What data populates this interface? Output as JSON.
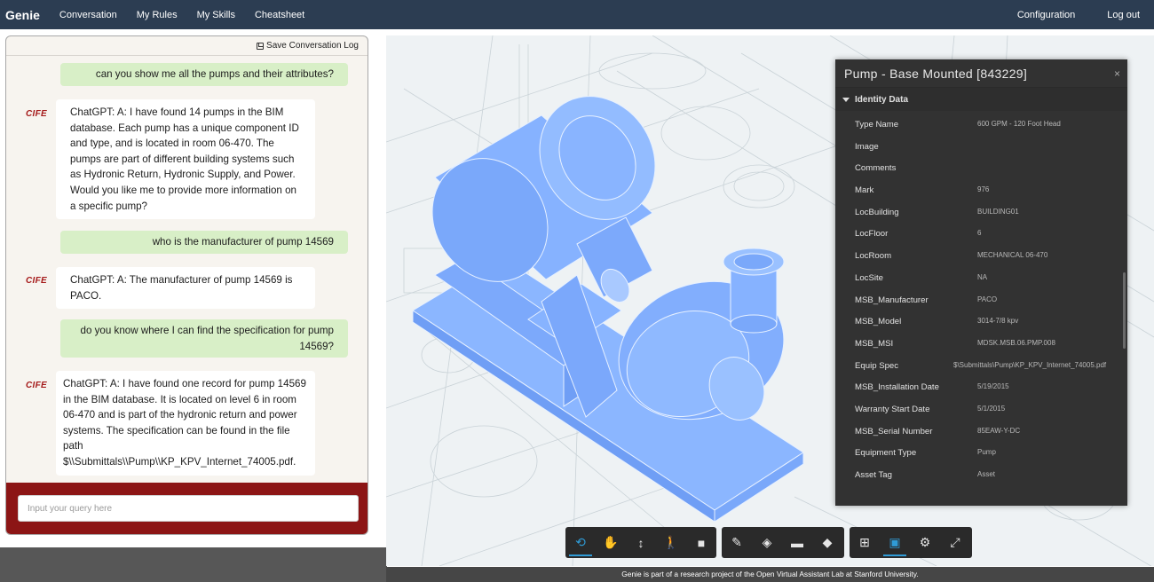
{
  "navbar": {
    "brand": "Genie",
    "links": [
      "Conversation",
      "My Rules",
      "My Skills",
      "Cheatsheet"
    ],
    "right_links": [
      "Configuration",
      "Log out"
    ]
  },
  "chat": {
    "save_log_label": "Save Conversation Log",
    "bot_logo_text": "CIFE",
    "messages": [
      {
        "role": "user",
        "text": "can you show me all the pumps and their attributes?"
      },
      {
        "role": "bot",
        "text": "ChatGPT: A: I have found 14 pumps in the BIM database. Each pump has a unique component ID and type, and is located in room 06-470. The pumps are part of different building systems such as Hydronic Return, Hydronic Supply, and Power. Would you like me to provide more information on a specific pump?"
      },
      {
        "role": "user",
        "text": "who is the manufacturer of pump 14569"
      },
      {
        "role": "bot",
        "text": "ChatGPT: A: The manufacturer of pump 14569 is PACO."
      },
      {
        "role": "user",
        "text": "do you know where I can find the specification for pump 14569?"
      },
      {
        "role": "bot",
        "text": "ChatGPT: A: I have found one record for pump 14569 in the BIM database. It is located on level 6 in room 06-470 and is part of the hydronic return and power systems. The specification can be found in the file path $\\\\Submittals\\\\Pump\\\\KP_KPV_Internet_74005.pdf."
      }
    ],
    "input_placeholder": "Input your query here"
  },
  "properties": {
    "title": "Pump - Base Mounted [843229]",
    "close_glyph": "×",
    "section": "Identity Data",
    "rows": [
      {
        "key": "Type Name",
        "value": "600 GPM - 120 Foot Head"
      },
      {
        "key": "Image",
        "value": ""
      },
      {
        "key": "Comments",
        "value": ""
      },
      {
        "key": "Mark",
        "value": "976"
      },
      {
        "key": "LocBuilding",
        "value": "BUILDING01"
      },
      {
        "key": "LocFloor",
        "value": "6"
      },
      {
        "key": "LocRoom",
        "value": "MECHANICAL 06-470"
      },
      {
        "key": "LocSite",
        "value": "NA"
      },
      {
        "key": "MSB_Manufacturer",
        "value": "PACO"
      },
      {
        "key": "MSB_Model",
        "value": "3014-7/8 kpv"
      },
      {
        "key": "MSB_MSI",
        "value": "MDSK.MSB.06.PMP.008"
      },
      {
        "key": "Equip Spec",
        "value": "$\\Submittals\\Pump\\KP_KPV_Internet_74005.pdf"
      },
      {
        "key": "MSB_Installation Date",
        "value": "5/19/2015"
      },
      {
        "key": "Warranty Start Date",
        "value": "5/1/2015"
      },
      {
        "key": "MSB_Serial Number",
        "value": "85EAW-Y-DC"
      },
      {
        "key": "Equipment Type",
        "value": "Pump"
      },
      {
        "key": "Asset Tag",
        "value": "Asset"
      },
      {
        "key": "",
        "value": ""
      }
    ]
  },
  "toolbar": {
    "groups": [
      [
        "orbit-icon",
        "pan-icon",
        "dolly-icon",
        "walk-icon",
        "camera-icon"
      ],
      [
        "measure-icon",
        "section-icon",
        "explode-icon",
        "model-icon"
      ],
      [
        "structure-icon",
        "properties-icon",
        "settings-icon",
        "fullscreen-icon"
      ]
    ],
    "active": [
      "orbit-icon",
      "properties-icon"
    ],
    "accent_color": "#2f9bd6"
  },
  "footer": {
    "text": "Genie is part of a research project of the Open Virtual Assistant Lab at Stanford University."
  },
  "colors": {
    "navbar": "#2c3d52",
    "user_bubble": "#d8efc7",
    "input_bar": "#8c1515",
    "pump_blue": "#7fb2ff"
  }
}
